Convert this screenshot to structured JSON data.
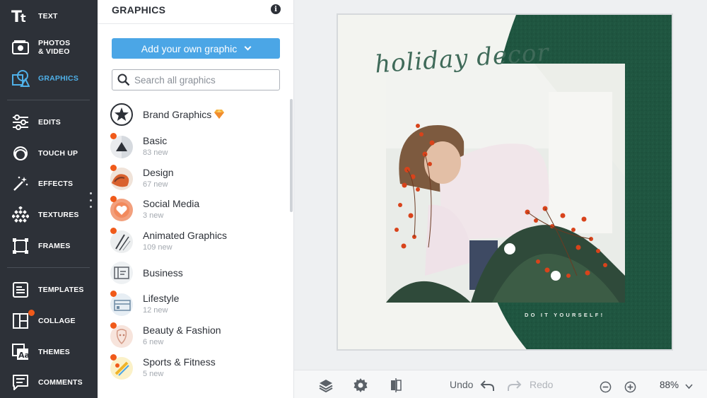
{
  "nav": {
    "items": [
      {
        "id": "text",
        "label": "TEXT",
        "icon": "text-icon"
      },
      {
        "id": "photos",
        "label": "PHOTOS\n& VIDEO",
        "icon": "photo-icon"
      },
      {
        "id": "graphics",
        "label": "GRAPHICS",
        "icon": "graphics-icon",
        "active": true
      },
      {
        "id": "edits",
        "label": "EDITS",
        "icon": "sliders-icon"
      },
      {
        "id": "touchup",
        "label": "TOUCH UP",
        "icon": "face-icon"
      },
      {
        "id": "effects",
        "label": "EFFECTS",
        "icon": "magic-wand-icon"
      },
      {
        "id": "textures",
        "label": "TEXTURES",
        "icon": "texture-icon"
      },
      {
        "id": "frames",
        "label": "FRAMES",
        "icon": "frame-icon"
      },
      {
        "id": "templates",
        "label": "TEMPLATES",
        "icon": "template-icon"
      },
      {
        "id": "collage",
        "label": "COLLAGE",
        "icon": "collage-icon"
      },
      {
        "id": "themes",
        "label": "THEMES",
        "icon": "themes-icon"
      },
      {
        "id": "comments",
        "label": "COMMENTS",
        "icon": "comment-icon"
      }
    ]
  },
  "panel": {
    "title": "GRAPHICS",
    "add_button": "Add your own graphic",
    "search_placeholder": "Search all graphics",
    "categories": [
      {
        "name": "Brand Graphics",
        "sub": "",
        "icon": "star-icon",
        "badge": "gem-icon"
      },
      {
        "name": "Basic",
        "sub": "83 new",
        "icon": "basic-shapes-icon"
      },
      {
        "name": "Design",
        "sub": "67 new",
        "icon": "design-icon"
      },
      {
        "name": "Social Media",
        "sub": "3 new",
        "icon": "heart-icon"
      },
      {
        "name": "Animated Graphics",
        "sub": "109 new",
        "icon": "animated-icon"
      },
      {
        "name": "Business",
        "sub": "",
        "icon": "business-icon"
      },
      {
        "name": "Lifestyle",
        "sub": "12 new",
        "icon": "lifestyle-icon"
      },
      {
        "name": "Beauty & Fashion",
        "sub": "6 new",
        "icon": "beauty-icon"
      },
      {
        "name": "Sports & Fitness",
        "sub": "5 new",
        "icon": "sports-icon"
      }
    ]
  },
  "canvas": {
    "script_title": "holiday decor",
    "tagline": "DO IT YOURSELF!"
  },
  "toolbar": {
    "undo": "Undo",
    "redo": "Redo",
    "zoom": "88%"
  },
  "colors": {
    "nav_bg": "#2d3138",
    "accent": "#4ba6e6",
    "notify": "#f05a1a",
    "green": "#1f5540"
  }
}
